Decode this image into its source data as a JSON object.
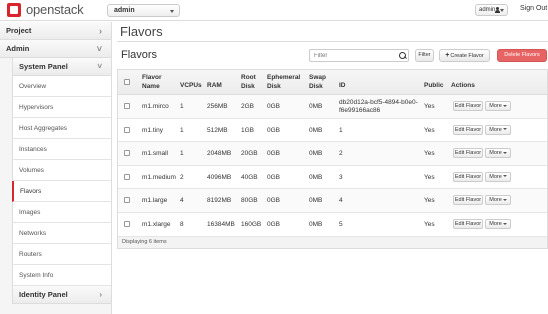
{
  "header": {
    "logo_text": "openstack",
    "project": "admin",
    "user": "admin",
    "signout": "Sign Out"
  },
  "sidebar": {
    "project_label": "Project",
    "admin_label": "Admin",
    "system_panel_label": "System Panel",
    "items": [
      {
        "label": "Overview"
      },
      {
        "label": "Hypervisors"
      },
      {
        "label": "Host Aggregates"
      },
      {
        "label": "Instances"
      },
      {
        "label": "Volumes"
      },
      {
        "label": "Flavors"
      },
      {
        "label": "Images"
      },
      {
        "label": "Networks"
      },
      {
        "label": "Routers"
      },
      {
        "label": "System Info"
      }
    ],
    "identity_panel_label": "Identity Panel"
  },
  "main": {
    "page_title": "Flavors",
    "table_title": "Flavors",
    "filter_placeholder": "Filter",
    "filter_button": "Filter",
    "create_button": "Create Flavor",
    "delete_button": "Delete Flavors",
    "columns": {
      "flavor_name": "Flavor Name",
      "vcpus": "VCPUs",
      "ram": "RAM",
      "root_disk": "Root Disk",
      "ephemeral_disk": "Ephemeral Disk",
      "swap_disk": "Swap Disk",
      "id": "ID",
      "public": "Public",
      "actions": "Actions"
    },
    "rows": [
      {
        "name": "m1.mirco",
        "vcpus": "1",
        "ram": "256MB",
        "root": "2GB",
        "ephemeral": "0GB",
        "swap": "0MB",
        "id_line1": "db20d12a-bcf5-4894-b0e0-",
        "id_line2": "f6e99166ac86",
        "public": "Yes",
        "edit": "Edit Flavor",
        "more": "More"
      },
      {
        "name": "m1.tiny",
        "vcpus": "1",
        "ram": "512MB",
        "root": "1GB",
        "ephemeral": "0GB",
        "swap": "0MB",
        "id_line1": "1",
        "id_line2": "",
        "public": "Yes",
        "edit": "Edit Flavor",
        "more": "More"
      },
      {
        "name": "m1.small",
        "vcpus": "1",
        "ram": "2048MB",
        "root": "20GB",
        "ephemeral": "0GB",
        "swap": "0MB",
        "id_line1": "2",
        "id_line2": "",
        "public": "Yes",
        "edit": "Edit Flavor",
        "more": "More"
      },
      {
        "name": "m1.medium",
        "vcpus": "2",
        "ram": "4096MB",
        "root": "40GB",
        "ephemeral": "0GB",
        "swap": "0MB",
        "id_line1": "3",
        "id_line2": "",
        "public": "Yes",
        "edit": "Edit Flavor",
        "more": "More"
      },
      {
        "name": "m1.large",
        "vcpus": "4",
        "ram": "8192MB",
        "root": "80GB",
        "ephemeral": "0GB",
        "swap": "0MB",
        "id_line1": "4",
        "id_line2": "",
        "public": "Yes",
        "edit": "Edit Flavor",
        "more": "More"
      },
      {
        "name": "m1.xlarge",
        "vcpus": "8",
        "ram": "16384MB",
        "root": "160GB",
        "ephemeral": "0GB",
        "swap": "0MB",
        "id_line1": "5",
        "id_line2": "",
        "public": "Yes",
        "edit": "Edit Flavor",
        "more": "More"
      }
    ],
    "footer": "Displaying 6 items"
  },
  "colors": {
    "accent": "#d9262c",
    "delete_button": "#e86464"
  },
  "icons": [
    "openstack-logo-icon",
    "user-icon",
    "chevron-right-icon",
    "chevron-down-icon",
    "search-icon",
    "plus-icon",
    "caret-down-icon"
  ]
}
